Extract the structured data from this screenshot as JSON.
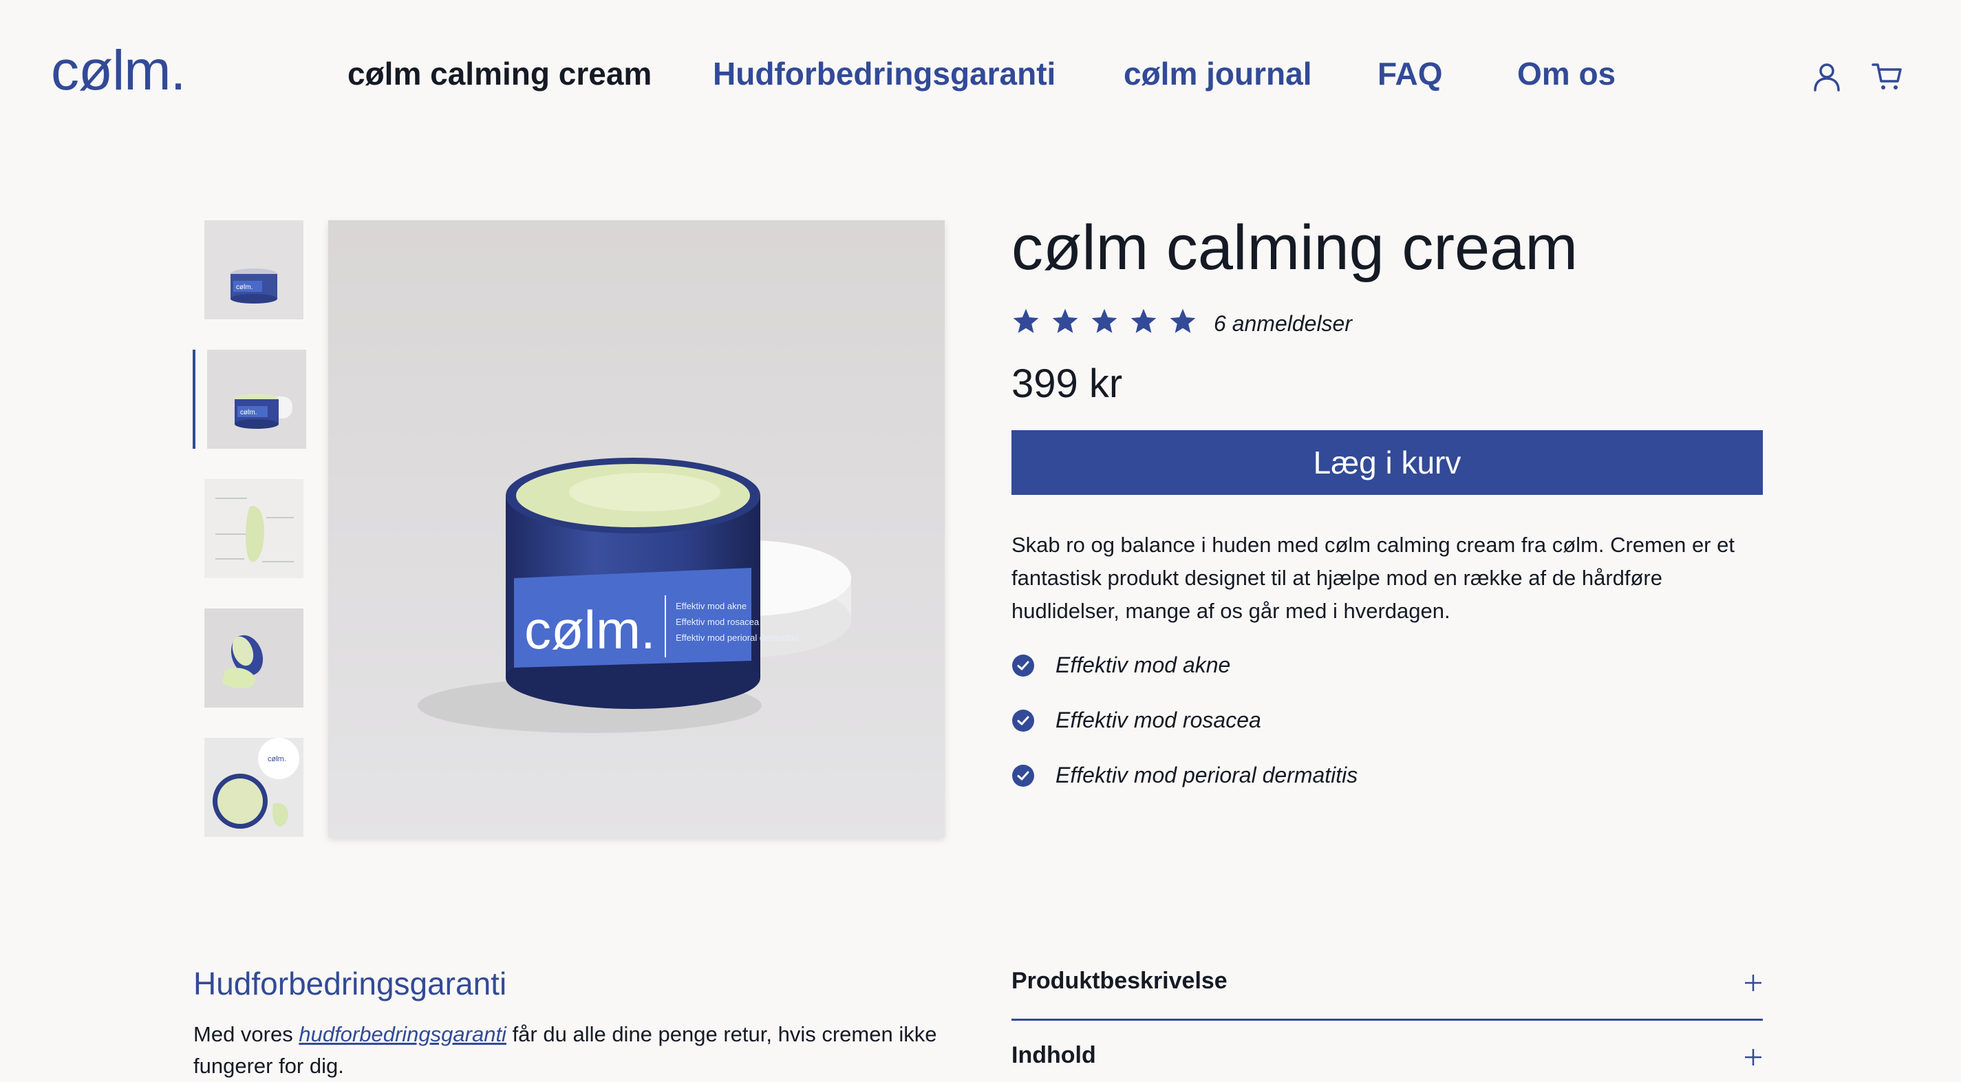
{
  "header": {
    "logo": "cølm.",
    "nav": [
      {
        "label": "cølm calming cream",
        "active": true
      },
      {
        "label": "Hudforbedringsgaranti",
        "active": false
      },
      {
        "label": "cølm journal",
        "active": false
      },
      {
        "label": "FAQ",
        "active": false
      },
      {
        "label": "Om os",
        "active": false
      }
    ],
    "icons": [
      "user-icon",
      "cart-icon"
    ]
  },
  "gallery": {
    "selected_thumbnail": 2,
    "thumbnail_count": 5,
    "main_image": {
      "jar_label_brand": "cølm.",
      "jar_label_lines": [
        "Effektiv mod akne",
        "Effektiv mod rosacea",
        "Effektiv mod perioral dermatitis"
      ]
    }
  },
  "product": {
    "title": "cølm calming cream",
    "rating": 5,
    "rating_max": 5,
    "reviews": "6 anmeldelser",
    "price": "399 kr",
    "add_to_cart": "Læg i kurv",
    "description": "Skab ro og balance i huden med cølm calming cream fra cølm. Cremen er et fantastisk produkt designet til at hjælpe mod en række af de hårdføre hudlidelser, mange af os går med i hverdagen.",
    "features": [
      "Effektiv mod akne",
      "Effektiv mod rosacea",
      "Effektiv mod perioral dermatitis"
    ]
  },
  "guarantee": {
    "title": "Hudforbedringsgaranti",
    "text_before": "Med vores ",
    "link": "hudforbedringsgaranti",
    "text_after": " får du alle dine penge retur, hvis cremen ikke fungerer for dig."
  },
  "accordion": [
    {
      "label": "Produktbeskrivelse"
    },
    {
      "label": "Indhold"
    }
  ],
  "colors": {
    "brand": "#324a97",
    "text": "#151a24",
    "background": "#f9f8f7"
  }
}
